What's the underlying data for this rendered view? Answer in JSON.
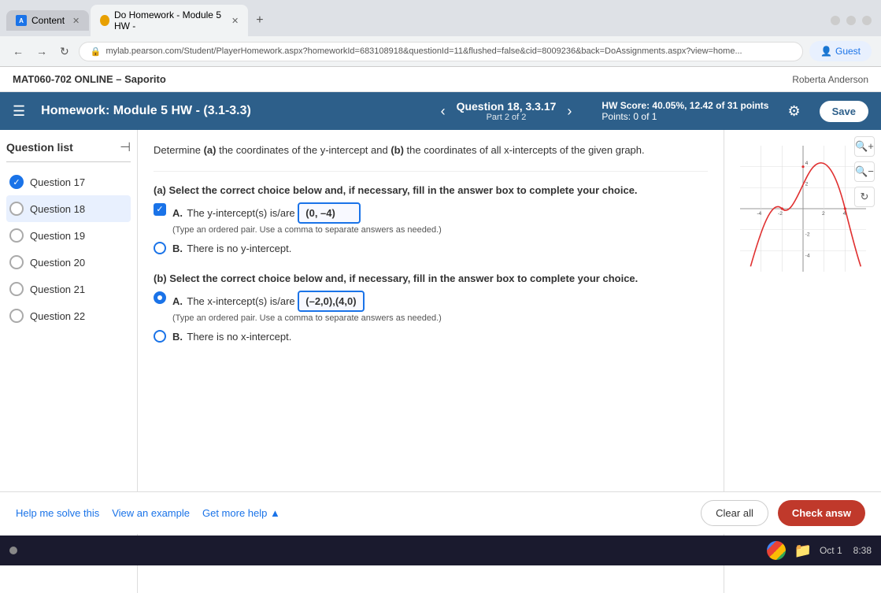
{
  "browser": {
    "tabs": [
      {
        "id": "content",
        "label": "Content",
        "favicon_type": "content",
        "active": false
      },
      {
        "id": "homework",
        "label": "Do Homework - Module 5 HW -",
        "favicon_type": "pearson",
        "active": true
      }
    ],
    "url": "mylab.pearson.com/Student/PlayerHomework.aspx?homeworkId=683108918&questionId=11&flushed=false&cid=8009236&back=DoAssignments.aspx?view=home...",
    "guest_label": "Guest"
  },
  "app_header": {
    "course": "MAT060-702 ONLINE – Saporito",
    "user": "Roberta Anderson"
  },
  "hw_header": {
    "title": "Homework: Module 5 HW - (3.1-3.3)",
    "question_label": "Question 18, 3.3.17",
    "question_sub": "Part 2 of 2",
    "score_title": "HW Score: 40.05%, 12.42 of 31 points",
    "points": "Points: 0 of 1",
    "save_label": "Save"
  },
  "sidebar": {
    "title": "Question list",
    "questions": [
      {
        "id": 17,
        "label": "Question 17",
        "status": "checked"
      },
      {
        "id": 18,
        "label": "Question 18",
        "status": "active"
      },
      {
        "id": 19,
        "label": "Question 19",
        "status": "empty"
      },
      {
        "id": 20,
        "label": "Question 20",
        "status": "empty"
      },
      {
        "id": 21,
        "label": "Question 21",
        "status": "empty"
      },
      {
        "id": 22,
        "label": "Question 22",
        "status": "empty"
      }
    ]
  },
  "question": {
    "instruction": "Determine (a) the coordinates of the y-intercept and (b) the coordinates of all x-intercepts of the given graph.",
    "part_a_label": "(a) Select the correct choice below and, if necessary, fill in the answer box to complete your choice.",
    "part_a_options": [
      {
        "letter": "A",
        "text": "The y-intercept(s) is/are",
        "answer": "(0, –4)",
        "hint": "(Type an ordered pair. Use a comma to separate answers as needed.)",
        "selected": true,
        "checked": true
      },
      {
        "letter": "B",
        "text": "There is no y-intercept.",
        "selected": false
      }
    ],
    "part_b_label": "(b) Select the correct choice below and, if necessary, fill in the answer box to complete your choice.",
    "part_b_options": [
      {
        "letter": "A",
        "text": "The x-intercept(s) is/are",
        "answer": "(–2,0),(4,0)",
        "hint": "(Type an ordered pair. Use a comma to separate answers as needed.)",
        "selected": true
      },
      {
        "letter": "B",
        "text": "There is no x-intercept.",
        "selected": false
      }
    ]
  },
  "bottom": {
    "help_me_solve": "Help me solve this",
    "view_example": "View an example",
    "get_more_help": "Get more help ▲",
    "clear_all": "Clear all",
    "check_answer": "Check answ"
  },
  "taskbar": {
    "date": "Oct 1",
    "time": "8:38"
  }
}
